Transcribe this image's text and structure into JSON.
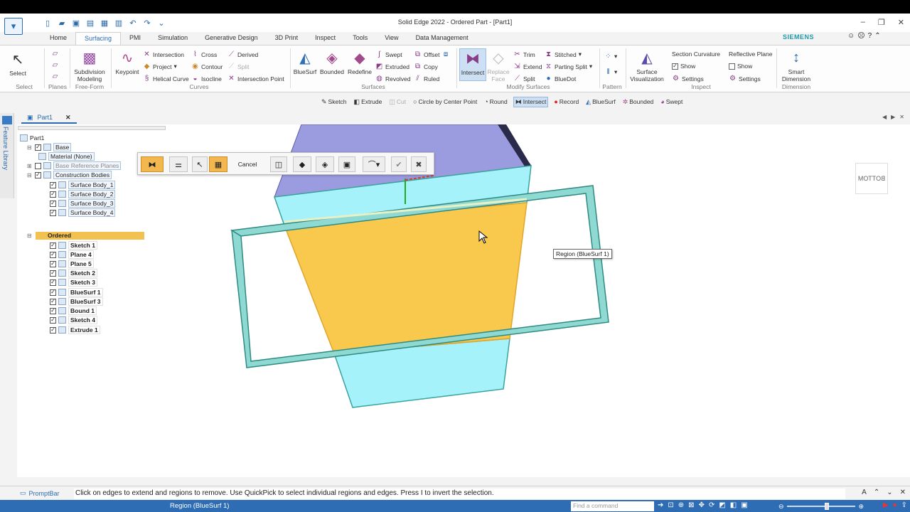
{
  "window": {
    "title": "Solid Edge 2022 - Ordered Part - [Part1]",
    "brand": "SIEMENS"
  },
  "tabs": [
    "Home",
    "Surfacing",
    "PMI",
    "Simulation",
    "Generative Design",
    "3D Print",
    "Inspect",
    "Tools",
    "View",
    "Data Management"
  ],
  "active_tab": "Surfacing",
  "ribbon": {
    "select": "Select",
    "select_group": "Select",
    "planes_group": "Planes",
    "subdivision": "Subdivision Modeling",
    "freeform_group": "Free-Form",
    "keypoint": "Keypoint",
    "curves": {
      "intersection": "Intersection",
      "project": "Project",
      "helical": "Helical Curve",
      "cross": "Cross",
      "contour": "Contour",
      "isocline": "Isocline",
      "derived": "Derived",
      "split": "Split",
      "intersection_point": "Intersection Point",
      "group": "Curves"
    },
    "surfaces": {
      "bluesurf": "BlueSurf",
      "bounded": "Bounded",
      "redefine": "Redefine",
      "swept": "Swept",
      "extruded": "Extruded",
      "revolved": "Revolved",
      "offset": "Offset",
      "copy": "Copy",
      "ruled": "Ruled",
      "group": "Surfaces"
    },
    "modify": {
      "intersect": "Intersect",
      "replace_face": "Replace Face",
      "trim": "Trim",
      "extend": "Extend",
      "split": "Split",
      "stitched": "Stitched",
      "parting_split": "Parting Split",
      "bluedot": "BlueDot",
      "group": "Modify Surfaces"
    },
    "pattern_group": "Pattern",
    "surface_vis": "Surface Visualization",
    "inspect": {
      "section_curvature": "Section Curvature",
      "show": "Show",
      "settings": "Settings",
      "reflective_plane": "Reflective Plane",
      "show2": "Show",
      "settings2": "Settings",
      "group": "Inspect"
    },
    "smart_dimension": "Smart Dimension",
    "dimension_group": "Dimension"
  },
  "command_bar": [
    {
      "label": "Sketch",
      "state": "normal"
    },
    {
      "label": "Extrude",
      "state": "normal"
    },
    {
      "label": "Cut",
      "state": "disabled"
    },
    {
      "label": "Circle by Center Point",
      "state": "normal"
    },
    {
      "label": "Round",
      "state": "normal"
    },
    {
      "label": "Intersect",
      "state": "active"
    },
    {
      "label": "Record",
      "state": "normal"
    },
    {
      "label": "BlueSurf",
      "state": "normal"
    },
    {
      "label": "Bounded",
      "state": "normal"
    },
    {
      "label": "Swept",
      "state": "normal"
    }
  ],
  "feature_library": "Feature Library",
  "doc_tab": "Part1",
  "tree": {
    "root": "Part1",
    "base": "Base",
    "material": "Material (None)",
    "base_ref_planes": "Base Reference Planes",
    "construction": "Construction Bodies",
    "surface_bodies": [
      "Surface Body_1",
      "Surface Body_2",
      "Surface Body_3",
      "Surface Body_4"
    ],
    "ordered": "Ordered",
    "features": [
      "Sketch 1",
      "Plane 4",
      "Plane 5",
      "Sketch 2",
      "Sketch 3",
      "BlueSurf 1",
      "BlueSurf 3",
      "Bound 1",
      "Sketch 4",
      "Extrude 1"
    ]
  },
  "quickbar": {
    "cancel": "Cancel"
  },
  "tooltip": "Region (BlueSurf 1)",
  "viewcube_label": "BOTTOM",
  "prompt": {
    "label": "PromptBar",
    "text": "Click on edges to extend and regions to remove. Use QuickPick to select individual regions and edges. Press I to invert the selection."
  },
  "status": {
    "text": "Region (BlueSurf 1)",
    "find_placeholder": "Find a command"
  },
  "colors": {
    "accent": "#2b6cb0",
    "region_highlight": "#f9c94e",
    "surface_cyan": "#a6f2fb",
    "top_face": "#9b9be0",
    "frame_teal": "#57b7b0",
    "statusbar": "#2e6db4"
  }
}
